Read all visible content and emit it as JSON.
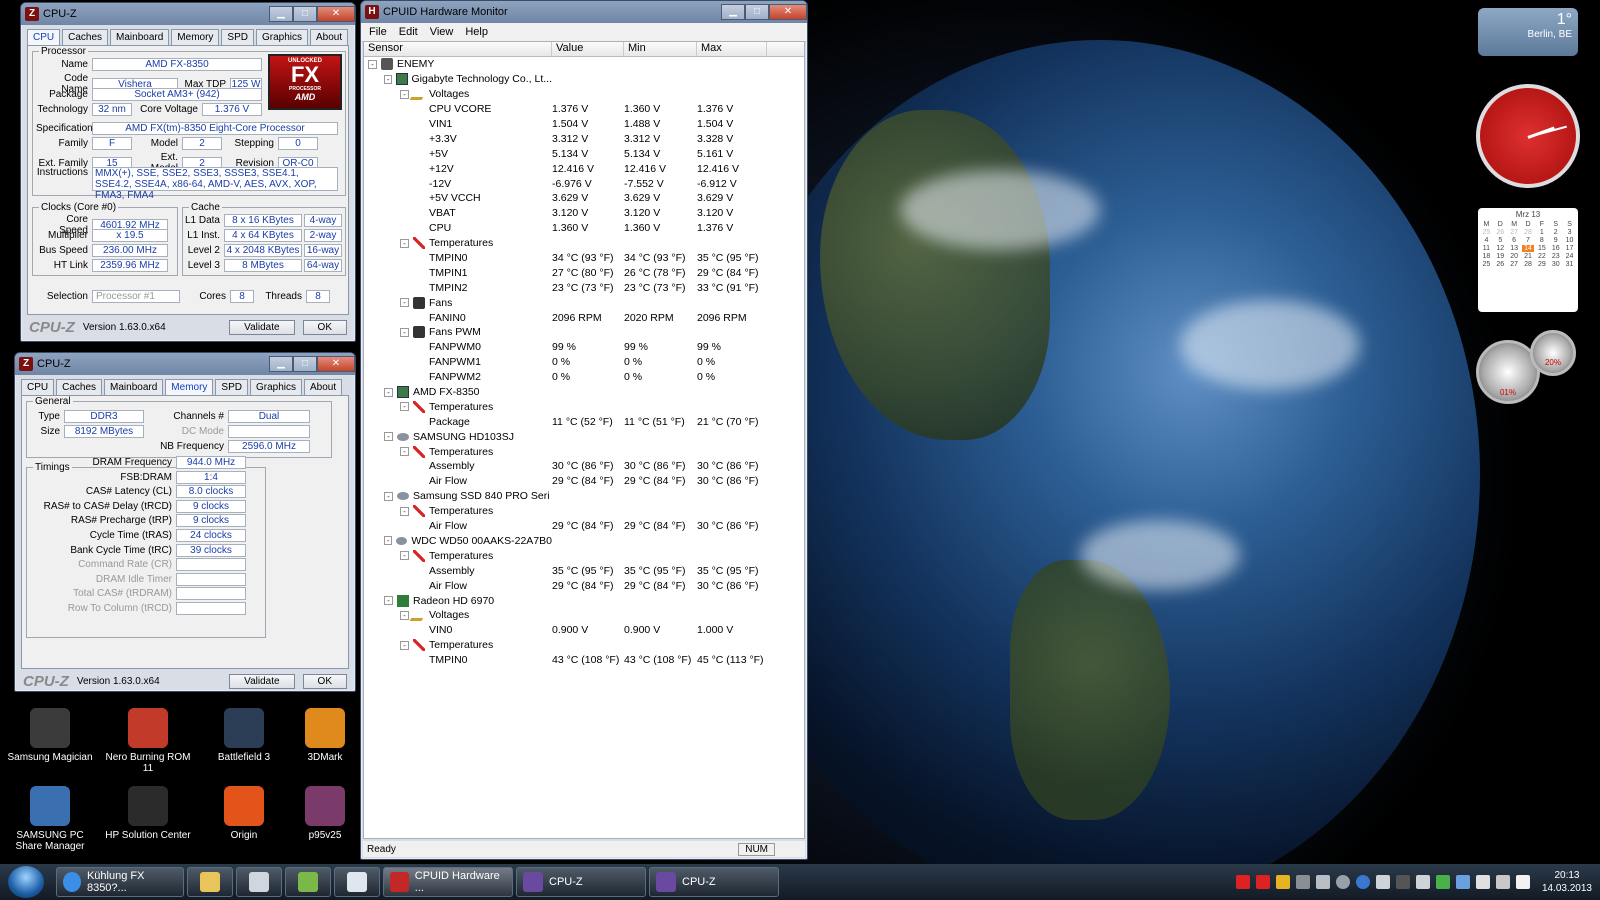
{
  "cpuz_cpu": {
    "title": "CPU-Z",
    "tabs": [
      "CPU",
      "Caches",
      "Mainboard",
      "Memory",
      "SPD",
      "Graphics",
      "About"
    ],
    "processor_legend": "Processor",
    "name_label": "Name",
    "name": "AMD FX-8350",
    "codename_label": "Code Name",
    "codename": "Vishera",
    "maxtdp_label": "Max TDP",
    "maxtdp": "125 W",
    "package_label": "Package",
    "package": "Socket AM3+ (942)",
    "technology_label": "Technology",
    "technology": "32 nm",
    "corevoltage_label": "Core Voltage",
    "corevoltage": "1.376 V",
    "spec_label": "Specification",
    "spec": "AMD FX(tm)-8350 Eight-Core Processor",
    "family_label": "Family",
    "family": "F",
    "model_label": "Model",
    "model": "2",
    "stepping_label": "Stepping",
    "stepping": "0",
    "extfamily_label": "Ext. Family",
    "extfamily": "15",
    "extmodel_label": "Ext. Model",
    "extmodel": "2",
    "revision_label": "Revision",
    "revision": "OR-C0",
    "instructions_label": "Instructions",
    "instructions": "MMX(+), SSE, SSE2, SSE3, SSSE3, SSE4.1, SSE4.2, SSE4A, x86-64, AMD-V, AES, AVX, XOP, FMA3, FMA4",
    "clocks_legend": "Clocks (Core #0)",
    "corespeed_label": "Core Speed",
    "corespeed": "4601.92 MHz",
    "multiplier_label": "Multiplier",
    "multiplier": "x 19.5",
    "busspeed_label": "Bus Speed",
    "busspeed": "236.00 MHz",
    "htlink_label": "HT Link",
    "htlink": "2359.96 MHz",
    "cache_legend": "Cache",
    "l1data_label": "L1 Data",
    "l1data": "8 x 16 KBytes",
    "l1data_way": "4-way",
    "l1inst_label": "L1 Inst.",
    "l1inst": "4 x 64 KBytes",
    "l1inst_way": "2-way",
    "level2_label": "Level 2",
    "level2": "4 x 2048 KBytes",
    "level2_way": "16-way",
    "level3_label": "Level 3",
    "level3": "8 MBytes",
    "level3_way": "64-way",
    "selection_label": "Selection",
    "selection": "Processor #1",
    "cores_label": "Cores",
    "cores": "8",
    "threads_label": "Threads",
    "threads": "8",
    "brand": "CPU-Z",
    "version": "Version 1.63.0.x64",
    "validate": "Validate",
    "ok": "OK",
    "logo_top": "UNLOCKED",
    "logo_fx": "FX",
    "logo_sub": "PROCESSOR",
    "logo_amd": "AMD"
  },
  "cpuz_mem": {
    "title": "CPU-Z",
    "tabs": [
      "CPU",
      "Caches",
      "Mainboard",
      "Memory",
      "SPD",
      "Graphics",
      "About"
    ],
    "general_legend": "General",
    "type_label": "Type",
    "type": "DDR3",
    "channels_label": "Channels #",
    "channels": "Dual",
    "size_label": "Size",
    "size": "8192 MBytes",
    "dcmode_label": "DC Mode",
    "dcmode": "",
    "nbfreq_label": "NB Frequency",
    "nbfreq": "2596.0 MHz",
    "timings_legend": "Timings",
    "timings": [
      {
        "label": "DRAM Frequency",
        "value": "944.0 MHz"
      },
      {
        "label": "FSB:DRAM",
        "value": "1:4"
      },
      {
        "label": "CAS# Latency (CL)",
        "value": "8.0 clocks"
      },
      {
        "label": "RAS# to CAS# Delay (tRCD)",
        "value": "9 clocks"
      },
      {
        "label": "RAS# Precharge (tRP)",
        "value": "9 clocks"
      },
      {
        "label": "Cycle Time (tRAS)",
        "value": "24 clocks"
      },
      {
        "label": "Bank Cycle Time (tRC)",
        "value": "39 clocks"
      },
      {
        "label": "Command Rate (CR)",
        "value": ""
      },
      {
        "label": "DRAM Idle Timer",
        "value": ""
      },
      {
        "label": "Total CAS# (tRDRAM)",
        "value": ""
      },
      {
        "label": "Row To Column (tRCD)",
        "value": ""
      }
    ],
    "brand": "CPU-Z",
    "version": "Version 1.63.0.x64",
    "validate": "Validate",
    "ok": "OK"
  },
  "hwmon": {
    "title": "CPUID Hardware Monitor",
    "menu": [
      "File",
      "Edit",
      "View",
      "Help"
    ],
    "columns": [
      "Sensor",
      "Value",
      "Min",
      "Max"
    ],
    "rows": [
      {
        "level": 0,
        "icon": "i-pc",
        "exp": "-",
        "name": "ENEMY",
        "v": "",
        "min": "",
        "max": ""
      },
      {
        "level": 1,
        "icon": "i-board",
        "exp": "-",
        "name": "Gigabyte Technology Co., Lt...",
        "v": "",
        "min": "",
        "max": ""
      },
      {
        "level": 2,
        "icon": "i-volt",
        "exp": "-",
        "name": "Voltages",
        "v": "",
        "min": "",
        "max": ""
      },
      {
        "level": 3,
        "name": "CPU VCORE",
        "v": "1.376 V",
        "min": "1.360 V",
        "max": "1.376 V"
      },
      {
        "level": 3,
        "name": "VIN1",
        "v": "1.504 V",
        "min": "1.488 V",
        "max": "1.504 V"
      },
      {
        "level": 3,
        "name": "+3.3V",
        "v": "3.312 V",
        "min": "3.312 V",
        "max": "3.328 V"
      },
      {
        "level": 3,
        "name": "+5V",
        "v": "5.134 V",
        "min": "5.134 V",
        "max": "5.161 V"
      },
      {
        "level": 3,
        "name": "+12V",
        "v": "12.416 V",
        "min": "12.416 V",
        "max": "12.416 V"
      },
      {
        "level": 3,
        "name": "-12V",
        "v": "-6.976 V",
        "min": "-7.552 V",
        "max": "-6.912 V"
      },
      {
        "level": 3,
        "name": "+5V VCCH",
        "v": "3.629 V",
        "min": "3.629 V",
        "max": "3.629 V"
      },
      {
        "level": 3,
        "name": "VBAT",
        "v": "3.120 V",
        "min": "3.120 V",
        "max": "3.120 V"
      },
      {
        "level": 3,
        "name": "CPU",
        "v": "1.360 V",
        "min": "1.360 V",
        "max": "1.376 V"
      },
      {
        "level": 2,
        "icon": "i-temp",
        "exp": "-",
        "name": "Temperatures",
        "v": "",
        "min": "",
        "max": ""
      },
      {
        "level": 3,
        "name": "TMPIN0",
        "v": "34 °C (93 °F)",
        "min": "34 °C (93 °F)",
        "max": "35 °C (95 °F)"
      },
      {
        "level": 3,
        "name": "TMPIN1",
        "v": "27 °C (80 °F)",
        "min": "26 °C (78 °F)",
        "max": "29 °C (84 °F)"
      },
      {
        "level": 3,
        "name": "TMPIN2",
        "v": "23 °C (73 °F)",
        "min": "23 °C (73 °F)",
        "max": "33 °C (91 °F)"
      },
      {
        "level": 2,
        "icon": "i-fan",
        "exp": "-",
        "name": "Fans",
        "v": "",
        "min": "",
        "max": ""
      },
      {
        "level": 3,
        "name": "FANIN0",
        "v": "2096 RPM",
        "min": "2020 RPM",
        "max": "2096 RPM"
      },
      {
        "level": 2,
        "icon": "i-fan",
        "exp": "-",
        "name": "Fans PWM",
        "v": "",
        "min": "",
        "max": ""
      },
      {
        "level": 3,
        "name": "FANPWM0",
        "v": "99 %",
        "min": "99 %",
        "max": "99 %"
      },
      {
        "level": 3,
        "name": "FANPWM1",
        "v": "0 %",
        "min": "0 %",
        "max": "0 %"
      },
      {
        "level": 3,
        "name": "FANPWM2",
        "v": "0 %",
        "min": "0 %",
        "max": "0 %"
      },
      {
        "level": 1,
        "icon": "i-board",
        "exp": "-",
        "name": "AMD FX-8350",
        "v": "",
        "min": "",
        "max": ""
      },
      {
        "level": 2,
        "icon": "i-temp",
        "exp": "-",
        "name": "Temperatures",
        "v": "",
        "min": "",
        "max": ""
      },
      {
        "level": 3,
        "name": "Package",
        "v": "11 °C (52 °F)",
        "min": "11 °C (51 °F)",
        "max": "21 °C (70 °F)"
      },
      {
        "level": 1,
        "icon": "i-disk",
        "exp": "-",
        "name": "SAMSUNG HD103SJ",
        "v": "",
        "min": "",
        "max": ""
      },
      {
        "level": 2,
        "icon": "i-temp",
        "exp": "-",
        "name": "Temperatures",
        "v": "",
        "min": "",
        "max": ""
      },
      {
        "level": 3,
        "name": "Assembly",
        "v": "30 °C (86 °F)",
        "min": "30 °C (86 °F)",
        "max": "30 °C (86 °F)"
      },
      {
        "level": 3,
        "name": "Air Flow",
        "v": "29 °C (84 °F)",
        "min": "29 °C (84 °F)",
        "max": "30 °C (86 °F)"
      },
      {
        "level": 1,
        "icon": "i-disk",
        "exp": "-",
        "name": "Samsung SSD 840 PRO Seri",
        "v": "",
        "min": "",
        "max": ""
      },
      {
        "level": 2,
        "icon": "i-temp",
        "exp": "-",
        "name": "Temperatures",
        "v": "",
        "min": "",
        "max": ""
      },
      {
        "level": 3,
        "name": "Air Flow",
        "v": "29 °C (84 °F)",
        "min": "29 °C (84 °F)",
        "max": "30 °C (86 °F)"
      },
      {
        "level": 1,
        "icon": "i-disk",
        "exp": "-",
        "name": "WDC WD50 00AAKS-22A7B0",
        "v": "",
        "min": "",
        "max": ""
      },
      {
        "level": 2,
        "icon": "i-temp",
        "exp": "-",
        "name": "Temperatures",
        "v": "",
        "min": "",
        "max": ""
      },
      {
        "level": 3,
        "name": "Assembly",
        "v": "35 °C (95 °F)",
        "min": "35 °C (95 °F)",
        "max": "35 °C (95 °F)"
      },
      {
        "level": 3,
        "name": "Air Flow",
        "v": "29 °C (84 °F)",
        "min": "29 °C (84 °F)",
        "max": "30 °C (86 °F)"
      },
      {
        "level": 1,
        "icon": "i-gpu",
        "exp": "-",
        "name": "Radeon HD 6970",
        "v": "",
        "min": "",
        "max": ""
      },
      {
        "level": 2,
        "icon": "i-volt",
        "exp": "-",
        "name": "Voltages",
        "v": "",
        "min": "",
        "max": ""
      },
      {
        "level": 3,
        "name": "VIN0",
        "v": "0.900 V",
        "min": "0.900 V",
        "max": "1.000 V"
      },
      {
        "level": 2,
        "icon": "i-temp",
        "exp": "-",
        "name": "Temperatures",
        "v": "",
        "min": "",
        "max": ""
      },
      {
        "level": 3,
        "name": "TMPIN0",
        "v": "43 °C (108 °F)",
        "min": "43 °C (108 °F)",
        "max": "45 °C (113 °F)"
      }
    ],
    "status": "Ready",
    "num": "NUM"
  },
  "desktop_icons": [
    {
      "label": "Samsung Magician",
      "color": "#3b3b3b"
    },
    {
      "label": "Nero Burning ROM 11",
      "color": "#c23a2a"
    },
    {
      "label": "Battlefield 3",
      "color": "#2c3e55"
    },
    {
      "label": "3DMark",
      "color": "#e08a1e"
    },
    {
      "label": "SAMSUNG PC Share Manager",
      "color": "#3a6fb0"
    },
    {
      "label": "HP Solution Center",
      "color": "#2b2b2b"
    },
    {
      "label": "Origin",
      "color": "#e2541a"
    },
    {
      "label": "p95v25",
      "color": "#7a3a6a"
    }
  ],
  "weather": {
    "temp": "1°",
    "city": "Berlin, BE"
  },
  "calendar": {
    "month": "Mrz 13",
    "weekdays": [
      "M",
      "D",
      "M",
      "D",
      "F",
      "S",
      "S"
    ],
    "days": [
      "25",
      "26",
      "27",
      "28",
      "1",
      "2",
      "3",
      "4",
      "5",
      "6",
      "7",
      "8",
      "9",
      "10",
      "11",
      "12",
      "13",
      "14",
      "15",
      "16",
      "17",
      "18",
      "19",
      "20",
      "21",
      "22",
      "23",
      "24",
      "25",
      "26",
      "27",
      "28",
      "29",
      "30",
      "31"
    ],
    "today": "14"
  },
  "meters": {
    "cpu": "01%",
    "mem": "20%"
  },
  "taskbar": {
    "ie_label": "Kühlung FX 8350?...",
    "hwmon_label": "CPUID Hardware ...",
    "cpuz1_label": "CPU-Z",
    "cpuz2_label": "CPU-Z",
    "time": "20:13",
    "date": "14.03.2013"
  }
}
